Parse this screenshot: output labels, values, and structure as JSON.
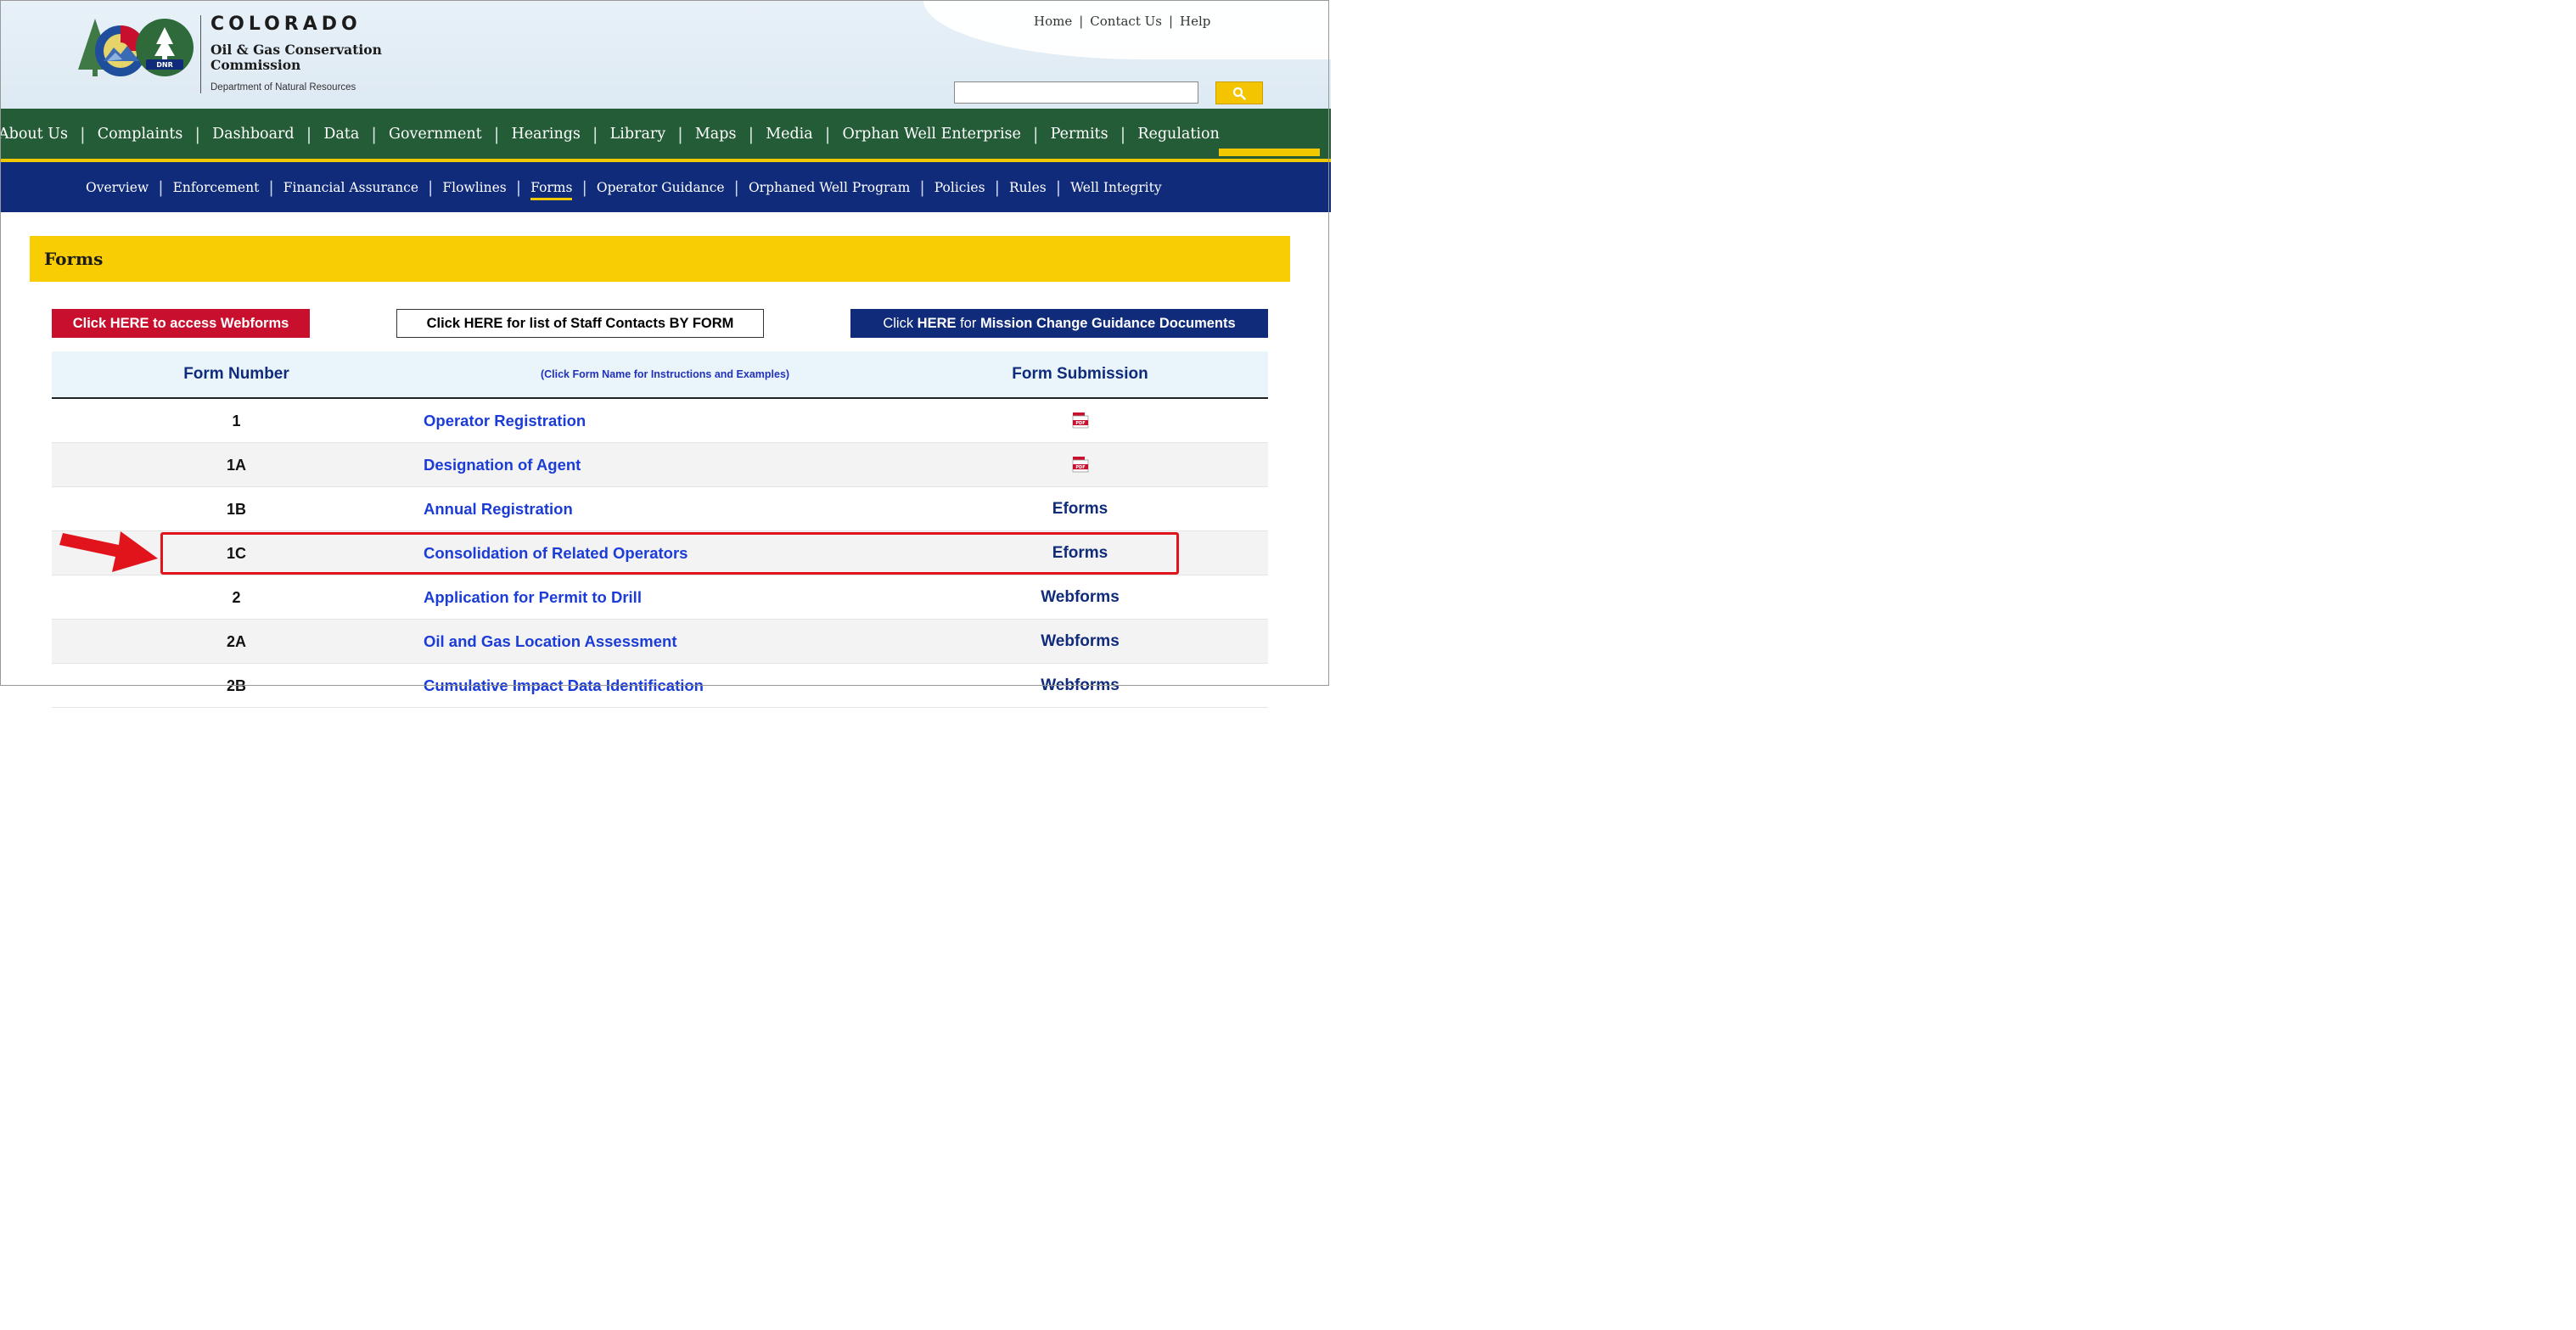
{
  "header": {
    "brand_title": "COLORADO",
    "brand_subtitle": "Oil & Gas Conservation Commission",
    "brand_dept": "Department of Natural Resources",
    "logo_badge": "DNR",
    "utility_links": [
      "Home",
      "Contact Us",
      "Help"
    ],
    "search_placeholder": ""
  },
  "main_nav": [
    "About Us",
    "Complaints",
    "Dashboard",
    "Data",
    "Government",
    "Hearings",
    "Library",
    "Maps",
    "Media",
    "Orphan Well Enterprise",
    "Permits",
    "Regulation"
  ],
  "main_nav_active": "Regulation",
  "sub_nav": [
    "Overview",
    "Enforcement",
    "Financial Assurance",
    "Flowlines",
    "Forms",
    "Operator Guidance",
    "Orphaned Well Program",
    "Policies",
    "Rules",
    "Well Integrity"
  ],
  "sub_nav_active": "Forms",
  "page": {
    "title": "Forms",
    "buttons": {
      "webforms": "Click HERE to access Webforms",
      "staff_contacts": "Click HERE for list of Staff Contacts BY FORM",
      "mission_prefix": "Click ",
      "mission_here": "HERE",
      "mission_for": " for ",
      "mission_docs": "Mission Change Guidance Documents"
    }
  },
  "table": {
    "headers": {
      "number": "Form Number",
      "name": "(Click Form Name for Instructions and Examples)",
      "submission": "Form Submission"
    },
    "rows": [
      {
        "number": "1",
        "name": "Operator Registration",
        "submission": "PDF",
        "type": "pdf"
      },
      {
        "number": "1A",
        "name": "Designation of Agent",
        "submission": "PDF",
        "type": "pdf"
      },
      {
        "number": "1B",
        "name": "Annual Registration",
        "submission": "Eforms",
        "type": "text"
      },
      {
        "number": "1C",
        "name": "Consolidation of Related Operators",
        "submission": "Eforms",
        "type": "text"
      },
      {
        "number": "2",
        "name": "Application for Permit to Drill",
        "submission": "Webforms",
        "type": "text"
      },
      {
        "number": "2A",
        "name": "Oil and Gas Location Assessment",
        "submission": "Webforms",
        "type": "text"
      },
      {
        "number": "2B",
        "name": "Cumulative Impact Data Identification",
        "submission": "Webforms",
        "type": "text"
      }
    ],
    "highlighted_row": "1C"
  },
  "colors": {
    "nav_green": "#255c38",
    "nav_blue": "#102b7a",
    "accent_yellow": "#f9cd04",
    "webforms_red": "#c8102e",
    "highlight_red": "#e1141c",
    "link_blue": "#1b3cd6"
  }
}
